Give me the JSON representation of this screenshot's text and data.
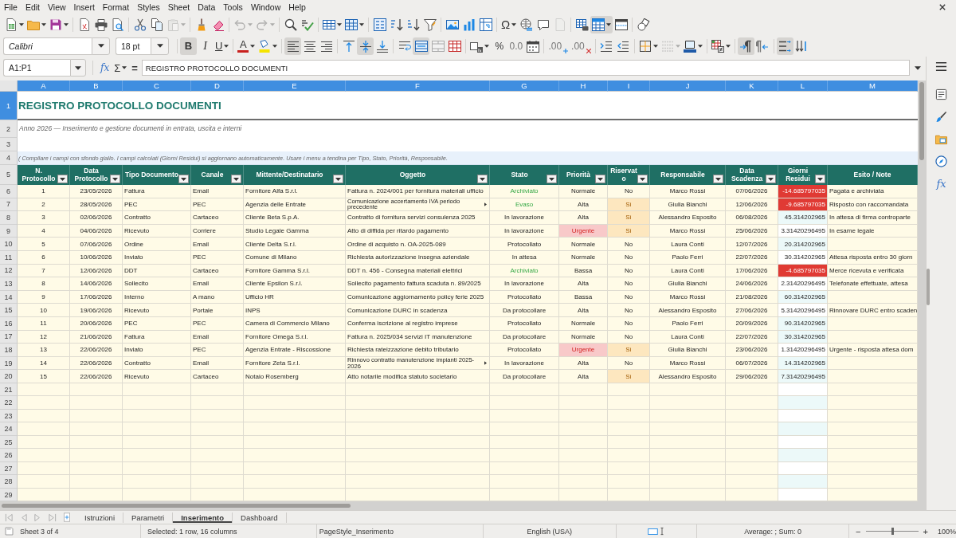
{
  "menu_bar": {
    "items": [
      "File",
      "Edit",
      "View",
      "Insert",
      "Format",
      "Styles",
      "Sheet",
      "Data",
      "Tools",
      "Window",
      "Help"
    ]
  },
  "standard_toolbar": [
    {
      "pressed": false,
      "disabled": false
    },
    {
      "pressed": false,
      "disabled": false
    },
    {
      "pressed": false,
      "disabled": false
    },
    {
      "pressed": false,
      "disabled": false
    },
    {
      "pressed": false,
      "disabled": false
    },
    {
      "pressed": false,
      "disabled": false
    },
    {
      "pressed": false,
      "disabled": false
    },
    {
      "pressed": false,
      "disabled": false
    },
    {
      "pressed": false,
      "disabled": true
    },
    {
      "pressed": false,
      "disabled": false
    },
    {
      "pressed": false,
      "disabled": false
    },
    {
      "pressed": false,
      "disabled": true
    },
    {
      "pressed": false,
      "disabled": true
    },
    {
      "pressed": false,
      "disabled": false
    },
    {
      "pressed": false,
      "disabled": false
    },
    {
      "pressed": false,
      "disabled": false
    },
    {
      "pressed": false,
      "disabled": false
    },
    {
      "pressed": false,
      "disabled": false
    },
    {
      "pressed": false,
      "disabled": false
    },
    {
      "pressed": false,
      "disabled": false
    },
    {
      "pressed": false,
      "disabled": false
    },
    {
      "pressed": false,
      "disabled": false
    },
    {
      "pressed": false,
      "disabled": false
    },
    {
      "pressed": false,
      "disabled": false
    },
    {
      "pressed": false,
      "disabled": false,
      "glyph": "Ω"
    },
    {
      "pressed": false,
      "disabled": false
    },
    {
      "pressed": false,
      "disabled": false
    },
    {
      "pressed": false,
      "disabled": true
    },
    {
      "pressed": false,
      "disabled": false
    },
    {
      "pressed": true,
      "disabled": false
    },
    {
      "pressed": false,
      "disabled": false
    },
    {
      "pressed": false,
      "disabled": false
    }
  ],
  "formatting_toolbar": {
    "font_name": "Calibri",
    "font_size": "18 pt",
    "buttons": [
      {
        "pressed": true,
        "disabled": false,
        "glyph": "B"
      },
      {
        "pressed": false,
        "disabled": false,
        "glyph": "I"
      },
      {
        "pressed": false,
        "disabled": false,
        "glyph": "U"
      },
      {
        "pressed": false,
        "disabled": false,
        "glyph": "A"
      },
      {
        "pressed": false,
        "disabled": false
      },
      {
        "pressed": true,
        "disabled": false
      },
      {
        "pressed": false,
        "disabled": false
      },
      {
        "pressed": false,
        "disabled": false
      },
      {
        "pressed": false,
        "disabled": false
      },
      {
        "pressed": true,
        "disabled": false
      },
      {
        "pressed": false,
        "disabled": false
      },
      {
        "pressed": false,
        "disabled": false
      },
      {
        "pressed": true,
        "disabled": false
      },
      {
        "pressed": false,
        "disabled": false
      },
      {
        "pressed": false,
        "disabled": false
      },
      {
        "pressed": false,
        "disabled": false
      },
      {
        "pressed": false,
        "disabled": false,
        "glyph": "%"
      },
      {
        "pressed": false,
        "disabled": false,
        "glyph": "0.0"
      },
      {
        "pressed": false,
        "disabled": false
      },
      {
        "pressed": false,
        "disabled": false,
        "glyph": ".00"
      },
      {
        "pressed": false,
        "disabled": false,
        "glyph": ".00"
      },
      {
        "pressed": false,
        "disabled": false
      },
      {
        "pressed": false,
        "disabled": false
      },
      {
        "pressed": false,
        "disabled": false
      },
      {
        "pressed": false,
        "disabled": true
      },
      {
        "pressed": false,
        "disabled": false
      },
      {
        "pressed": false,
        "disabled": false
      },
      {
        "pressed": true,
        "disabled": false
      },
      {
        "pressed": false,
        "disabled": false
      },
      {
        "pressed": true,
        "disabled": false
      },
      {
        "pressed": false,
        "disabled": false
      }
    ]
  },
  "formula_bar": {
    "name_box": "A1:P1",
    "function_wizard": "fx",
    "sum": "Σ",
    "formula": "=",
    "content": "REGISTRO PROTOCOLLO DOCUMENTI"
  },
  "sidebar": {
    "functions_glyph": "fx"
  },
  "sheet": {
    "columns": [
      {
        "label": "A",
        "selected": true
      },
      {
        "label": "B",
        "selected": true
      },
      {
        "label": "C",
        "selected": true
      },
      {
        "label": "D",
        "selected": true
      },
      {
        "label": "E",
        "selected": true
      },
      {
        "label": "F",
        "selected": true
      },
      {
        "label": "G",
        "selected": true
      },
      {
        "label": "H",
        "selected": true
      },
      {
        "label": "I",
        "selected": true
      },
      {
        "label": "J",
        "selected": true
      },
      {
        "label": "K",
        "selected": true
      },
      {
        "label": "L",
        "selected": true
      },
      {
        "label": "M",
        "selected": true
      }
    ],
    "rows": [
      {
        "kind": "title",
        "number": "1",
        "selected": true,
        "text": "REGISTRO PROTOCOLLO DOCUMENTI"
      },
      {
        "kind": "subtitle",
        "number": "2",
        "selected": false,
        "text": "Anno 2026 — Inserimento e gestione documenti in entrata, uscita e interni"
      },
      {
        "kind": "blank",
        "number": "3",
        "selected": false
      },
      {
        "kind": "note",
        "number": "4",
        "selected": false,
        "text": "( Compilare i campi con sfondo giallo. I campi calcolati (Giorni Residui) si aggiornano automaticamente. Usare i menu a tendina per Tipo, Stato, Priorità, Responsabile."
      },
      {
        "kind": "header",
        "number": "5",
        "selected": false,
        "columns": [
          {
            "label": "N. Protocollo",
            "filter": true
          },
          {
            "label": "Data Protocollo",
            "filter": true
          },
          {
            "label": "Tipo Documento",
            "filter": true
          },
          {
            "label": "Canale",
            "filter": true
          },
          {
            "label": "Mittente/Destinatario",
            "filter": true
          },
          {
            "label": "Oggetto",
            "filter": true
          },
          {
            "label": "Stato",
            "filter": true
          },
          {
            "label": "Priorità",
            "filter": true
          },
          {
            "label": "Riservato",
            "filter": true
          },
          {
            "label": "Responsabile",
            "filter": true
          },
          {
            "label": "Data Scadenza",
            "filter": true
          },
          {
            "label": "Giorni Residui",
            "filter": true
          },
          {
            "label": "Esito / Note",
            "filter": false
          }
        ]
      },
      {
        "kind": "record",
        "number": "6",
        "selected": false,
        "done": true,
        "urgent": false,
        "reserved": false,
        "overdue": true,
        "overflow": false,
        "n": "1",
        "data": "23/05/2026",
        "tipo": "Fattura",
        "canale": "Email",
        "mittente": "Fornitore Alfa S.r.l.",
        "oggetto": "Fattura n. 2024/001 per fornitura materiali ufficio",
        "stato": "Archiviato",
        "priorita": "Normale",
        "riservato": "No",
        "responsabile": "Marco Rossi",
        "scadenza": "07/06/2026",
        "giorni": "-14.685797035",
        "esito": "Pagata e archiviata"
      },
      {
        "kind": "record",
        "number": "7",
        "selected": false,
        "done": true,
        "urgent": false,
        "reserved": true,
        "overdue": true,
        "overflow": true,
        "n": "2",
        "data": "28/05/2026",
        "tipo": "PEC",
        "canale": "PEC",
        "mittente": "Agenzia delle Entrate",
        "oggetto": "Comunicazione accertamento IVA periodo precedente",
        "stato": "Evaso",
        "priorita": "Alta",
        "riservato": "Sì",
        "responsabile": "Giulia Bianchi",
        "scadenza": "12/06/2026",
        "giorni": "-9.685797035",
        "esito": "Risposto con raccomandata"
      },
      {
        "kind": "record",
        "number": "8",
        "selected": false,
        "done": false,
        "urgent": false,
        "reserved": true,
        "overdue": false,
        "highlight": true,
        "overflow": false,
        "n": "3",
        "data": "02/06/2026",
        "tipo": "Contratto",
        "canale": "Cartaceo",
        "mittente": "Cliente Beta S.p.A.",
        "oggetto": "Contratto di fornitura servizi consulenza 2025",
        "stato": "In lavorazione",
        "priorita": "Alta",
        "riservato": "Sì",
        "responsabile": "Alessandro Esposito",
        "scadenza": "06/08/2026",
        "giorni": "45.314202965",
        "esito": "In attesa di firma controparte"
      },
      {
        "kind": "record",
        "number": "9",
        "selected": false,
        "done": false,
        "urgent": true,
        "reserved": true,
        "overdue": false,
        "highlight": false,
        "overflow": false,
        "n": "4",
        "data": "04/06/2026",
        "tipo": "Ricevuto",
        "canale": "Corriere",
        "mittente": "Studio Legale Gamma",
        "oggetto": "Atto di diffida per ritardo pagamento",
        "stato": "In lavorazione",
        "priorita": "Urgente",
        "riservato": "Sì",
        "responsabile": "Marco Rossi",
        "scadenza": "25/06/2026",
        "giorni": "3.31420296495",
        "esito": "In esame legale"
      },
      {
        "kind": "record",
        "number": "10",
        "selected": false,
        "done": false,
        "urgent": false,
        "reserved": false,
        "overdue": false,
        "highlight": true,
        "overflow": false,
        "n": "5",
        "data": "07/06/2026",
        "tipo": "Ordine",
        "canale": "Email",
        "mittente": "Cliente Delta S.r.l.",
        "oggetto": "Ordine di acquisto n. OA-2025-089",
        "stato": "Protocollato",
        "priorita": "Normale",
        "riservato": "No",
        "responsabile": "Laura Conti",
        "scadenza": "12/07/2026",
        "giorni": "20.314202965"
      },
      {
        "kind": "record",
        "number": "11",
        "selected": false,
        "done": false,
        "urgent": false,
        "reserved": false,
        "overdue": false,
        "highlight": false,
        "overflow": false,
        "n": "6",
        "data": "10/06/2026",
        "tipo": "Inviato",
        "canale": "PEC",
        "mittente": "Comune di Milano",
        "oggetto": "Richiesta autorizzazione insegna aziendale",
        "stato": "In attesa",
        "priorita": "Normale",
        "riservato": "No",
        "responsabile": "Paolo Ferri",
        "scadenza": "22/07/2026",
        "giorni": "30.314202965",
        "esito": "Attesa risposta entro 30 giorn"
      },
      {
        "kind": "record",
        "number": "12",
        "selected": false,
        "done": true,
        "urgent": false,
        "reserved": false,
        "overdue": true,
        "overflow": false,
        "n": "7",
        "data": "12/06/2026",
        "tipo": "DDT",
        "canale": "Cartaceo",
        "mittente": "Fornitore Gamma S.r.l.",
        "oggetto": "DDT n. 456 - Consegna materiali elettrici",
        "stato": "Archiviato",
        "priorita": "Bassa",
        "riservato": "No",
        "responsabile": "Laura Conti",
        "scadenza": "17/06/2026",
        "giorni": "-4.685797035",
        "esito": "Merce ricevuta e verificata"
      },
      {
        "kind": "record",
        "number": "13",
        "selected": false,
        "done": false,
        "urgent": false,
        "reserved": false,
        "overdue": false,
        "highlight": false,
        "overflow": false,
        "n": "8",
        "data": "14/06/2026",
        "tipo": "Sollecito",
        "canale": "Email",
        "mittente": "Cliente Epsilon S.r.l.",
        "oggetto": "Sollecito pagamento fattura scaduta n. 89/2025",
        "stato": "In lavorazione",
        "priorita": "Alta",
        "riservato": "No",
        "responsabile": "Giulia Bianchi",
        "scadenza": "24/06/2026",
        "giorni": "2.31420296495",
        "esito": "Telefonate effettuate, attesa"
      },
      {
        "kind": "record",
        "number": "14",
        "selected": false,
        "done": false,
        "urgent": false,
        "reserved": false,
        "overdue": false,
        "highlight": true,
        "overflow": false,
        "n": "9",
        "data": "17/06/2026",
        "tipo": "Interno",
        "canale": "A mano",
        "mittente": "Ufficio HR",
        "oggetto": "Comunicazione aggiornamento policy ferie 2025",
        "stato": "Protocollato",
        "priorita": "Bassa",
        "riservato": "No",
        "responsabile": "Marco Rossi",
        "scadenza": "21/08/2026",
        "giorni": "60.314202965"
      },
      {
        "kind": "record",
        "number": "15",
        "selected": false,
        "done": false,
        "urgent": false,
        "reserved": false,
        "overdue": false,
        "highlight": false,
        "overflow": false,
        "n": "10",
        "data": "19/06/2026",
        "tipo": "Ricevuto",
        "canale": "Portale",
        "mittente": "INPS",
        "oggetto": "Comunicazione DURC in scadenza",
        "stato": "Da protocollare",
        "priorita": "Alta",
        "riservato": "No",
        "responsabile": "Alessandro Esposito",
        "scadenza": "27/06/2026",
        "giorni": "5.31420296495",
        "esito": "Rinnovare DURC entro scaden"
      },
      {
        "kind": "record",
        "number": "16",
        "selected": false,
        "done": false,
        "urgent": false,
        "reserved": false,
        "overdue": false,
        "highlight": true,
        "overflow": false,
        "n": "11",
        "data": "20/06/2026",
        "tipo": "PEC",
        "canale": "PEC",
        "mittente": "Camera di Commercio Milano",
        "oggetto": "Conferma iscrizione al registro imprese",
        "stato": "Protocollato",
        "priorita": "Normale",
        "riservato": "No",
        "responsabile": "Paolo Ferri",
        "scadenza": "20/09/2026",
        "giorni": "90.314202965"
      },
      {
        "kind": "record",
        "number": "17",
        "selected": false,
        "done": false,
        "urgent": false,
        "reserved": false,
        "overdue": false,
        "highlight": true,
        "overflow": false,
        "n": "12",
        "data": "21/06/2026",
        "tipo": "Fattura",
        "canale": "Email",
        "mittente": "Fornitore Omega S.r.l.",
        "oggetto": "Fattura n. 2025/034 servizi IT manutenzione",
        "stato": "Da protocollare",
        "priorita": "Normale",
        "riservato": "No",
        "responsabile": "Laura Conti",
        "scadenza": "22/07/2026",
        "giorni": "30.314202965"
      },
      {
        "kind": "record",
        "number": "18",
        "selected": false,
        "done": false,
        "urgent": true,
        "reserved": true,
        "overdue": false,
        "highlight": false,
        "overflow": false,
        "n": "13",
        "data": "22/06/2026",
        "tipo": "Inviato",
        "canale": "PEC",
        "mittente": "Agenzia Entrate - Riscossione",
        "oggetto": "Richiesta rateizzazione debito tributario",
        "stato": "Protocollato",
        "priorita": "Urgente",
        "riservato": "Sì",
        "responsabile": "Giulia Bianchi",
        "scadenza": "23/06/2026",
        "giorni": "1.31420296495",
        "esito": "Urgente - risposta attesa dom"
      },
      {
        "kind": "record",
        "number": "19",
        "selected": false,
        "done": false,
        "urgent": false,
        "reserved": false,
        "overdue": false,
        "highlight": true,
        "overflow": true,
        "n": "14",
        "data": "22/06/2026",
        "tipo": "Contratto",
        "canale": "Email",
        "mittente": "Fornitore Zeta S.r.l.",
        "oggetto": "Rinnovo contratto manutenzione impianti 2025-2026",
        "stato": "In lavorazione",
        "priorita": "Alta",
        "riservato": "No",
        "responsabile": "Marco Rossi",
        "scadenza": "06/07/2026",
        "giorni": "14.314202965"
      },
      {
        "kind": "record",
        "number": "20",
        "selected": false,
        "done": false,
        "urgent": false,
        "reserved": true,
        "overdue": false,
        "highlight": true,
        "overflow": false,
        "n": "15",
        "data": "22/06/2026",
        "tipo": "Ricevuto",
        "canale": "Cartaceo",
        "mittente": "Notaio Rosemberg",
        "oggetto": "Atto notarile modifica statuto societario",
        "stato": "Da protocollare",
        "priorita": "Alta",
        "riservato": "Sì",
        "responsabile": "Alessandro Esposito",
        "scadenza": "29/06/2026",
        "giorni": "7.31420296495"
      },
      {
        "kind": "empty",
        "number": "21",
        "selected": false,
        "highlight": false
      },
      {
        "kind": "empty",
        "number": "22",
        "selected": false,
        "highlight": true
      },
      {
        "kind": "empty",
        "number": "23",
        "selected": false,
        "highlight": false
      },
      {
        "kind": "empty",
        "number": "24",
        "selected": false,
        "highlight": true
      },
      {
        "kind": "empty",
        "number": "25",
        "selected": false,
        "highlight": false
      },
      {
        "kind": "empty",
        "number": "26",
        "selected": false,
        "highlight": true
      },
      {
        "kind": "empty",
        "number": "27",
        "selected": false,
        "highlight": false
      },
      {
        "kind": "empty",
        "number": "28",
        "selected": false,
        "highlight": true
      },
      {
        "kind": "empty",
        "number": "29",
        "selected": false,
        "highlight": false
      }
    ]
  },
  "sheet_tabs": [
    {
      "label": "Istruzioni",
      "selected": false
    },
    {
      "label": "Parametri",
      "selected": false
    },
    {
      "label": "Inserimento",
      "selected": true
    },
    {
      "label": "Dashboard",
      "selected": false
    }
  ],
  "status_bar": {
    "sheet": "Sheet 3 of 4",
    "selection": "Selected: 1 row, 16 columns",
    "page_style": "PageStyle_Inserimento",
    "language": "English (USA)",
    "summary": "Average: ; Sum: 0",
    "zoom_out": "−",
    "zoom": {
      "level": 0.5
    },
    "zoom_in": "+",
    "zoom_percent": "100%"
  }
}
